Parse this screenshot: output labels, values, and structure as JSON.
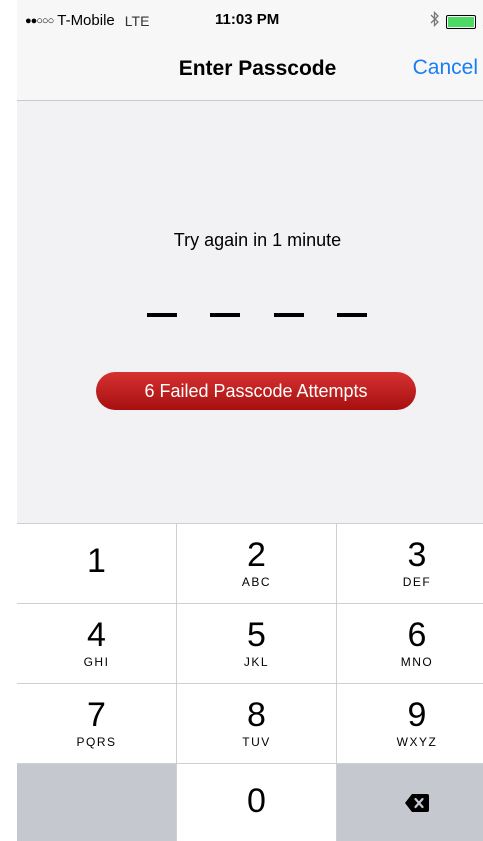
{
  "status_bar": {
    "signal": "●●○○○",
    "carrier": "T-Mobile",
    "network": "LTE",
    "time": "11:03 PM",
    "bluetooth_icon": "bluetooth-icon",
    "battery_level": 1.0,
    "bolt": "⚡"
  },
  "navbar": {
    "title": "Enter Passcode",
    "cancel_label": "Cancel"
  },
  "content": {
    "prompt": "Try again in 1 minute",
    "entered_digits": 0,
    "total_digits": 4,
    "failed_badge": "6 Failed Passcode Attempts"
  },
  "keypad": {
    "keys": [
      {
        "digit": "1",
        "letters": ""
      },
      {
        "digit": "2",
        "letters": "ABC"
      },
      {
        "digit": "3",
        "letters": "DEF"
      },
      {
        "digit": "4",
        "letters": "GHI"
      },
      {
        "digit": "5",
        "letters": "JKL"
      },
      {
        "digit": "6",
        "letters": "MNO"
      },
      {
        "digit": "7",
        "letters": "PQRS"
      },
      {
        "digit": "8",
        "letters": "TUV"
      },
      {
        "digit": "9",
        "letters": "WXYZ"
      },
      {
        "digit": "0",
        "letters": ""
      }
    ],
    "delete_icon": "delete-backspace-icon"
  },
  "colors": {
    "accent": "#1a7ef2",
    "badge_red": "#c21c1c",
    "keypad_dark": "#c5c8cf",
    "battery_green": "#4cd964"
  }
}
